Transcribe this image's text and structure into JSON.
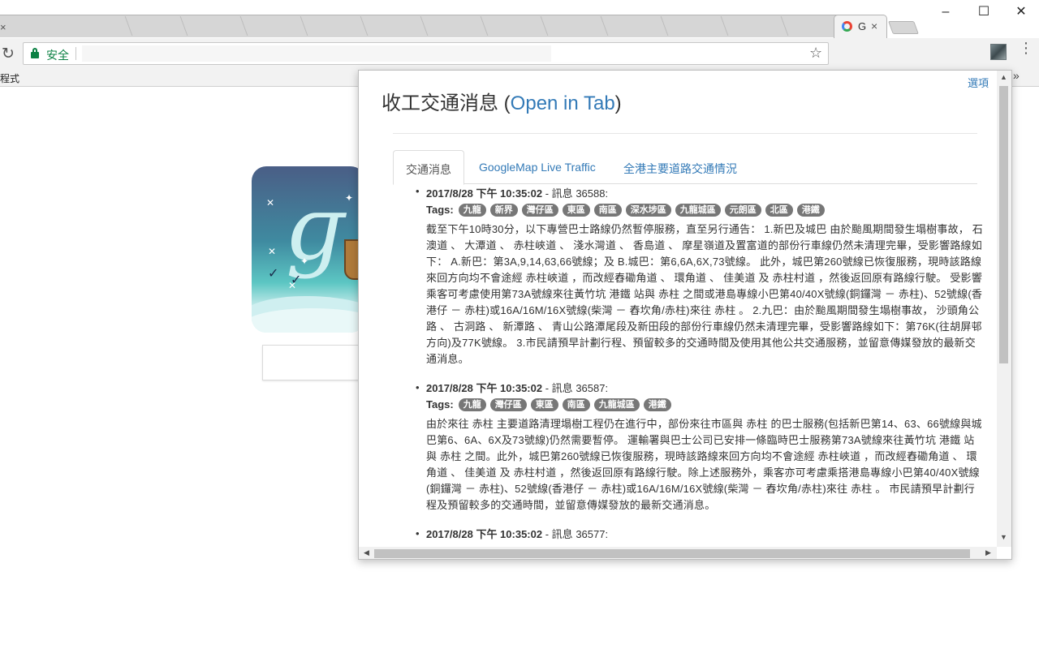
{
  "browser": {
    "active_tab_title": "G",
    "tab_close": "×",
    "omnibox_secure_label": "安全",
    "bookmark_label": "程式",
    "left_tab_close": "×",
    "bookmarks_more": "»"
  },
  "popup": {
    "options_label": "選項",
    "title": "收工交通消息 (",
    "title_link": "Open in Tab",
    "title_end": ")",
    "tabs": [
      {
        "label": "交通消息",
        "active": true
      },
      {
        "label": "GoogleMap Live Traffic",
        "active": false
      },
      {
        "label": "全港主要道路交通情況",
        "active": false
      }
    ],
    "tags_label": "Tags:",
    "msg_prefix": "- 訊息",
    "news": [
      {
        "datetime": "2017/8/28 下午 10:35:02",
        "msg_id": "36588:",
        "tags": [
          "九龍",
          "新界",
          "灣仔區",
          "東區",
          "南區",
          "深水埗區",
          "九龍城區",
          "元朗區",
          "北區",
          "港鐵"
        ],
        "body": "截至下午10時30分，以下專營巴士路線仍然暫停服務，直至另行通告： 1.新巴及城巴 由於颱風期間發生塌樹事故， 石澳道 、 大潭道 、 赤柱峽道 、 淺水灣道 、 香島道 、 摩星嶺道及置富道的部份行車線仍然未清理完畢，受影響路線如下： A.新巴：第3A,9,14,63,66號線；及 B.城巴：第6,6A,6X,73號線。 此外，城巴第260號線已恢復服務，現時該路線來回方向均不會途經 赤柱峽道 ，而改經舂磡角道 、 環角道 、 佳美道 及 赤柱村道 ，然後返回原有路線行駛。 受影響乘客可考慮使用第73A號線來往黃竹坑 港鐵 站與 赤柱 之間或港島專線小巴第40/40X號線(銅鑼灣 － 赤柱)、52號線(香港仔 － 赤柱)或16A/16M/16X號線(柴灣 － 舂坎角/赤柱)來往 赤柱 。 2.九巴：由於颱風期間發生塌樹事故， 沙頭角公路 、 古洞路 、 新潭路 、 青山公路潭尾段及新田段的部份行車線仍然未清理完畢，受影響路線如下：第76K(往胡屏邨方向)及77K號線。 3.市民請預早計劃行程、預留較多的交通時間及使用其他公共交通服務，並留意傳媒發放的最新交通消息。"
      },
      {
        "datetime": "2017/8/28 下午 10:35:02",
        "msg_id": "36587:",
        "tags": [
          "九龍",
          "灣仔區",
          "東區",
          "南區",
          "九龍城區",
          "港鐵"
        ],
        "body": "由於來往 赤柱 主要道路清理塌樹工程仍在進行中，部份來往市區與 赤柱 的巴士服務(包括新巴第14、63、66號線與城巴第6、6A、6X及73號線)仍然需要暫停。 運輸署與巴士公司已安排一條臨時巴士服務第73A號線來往黃竹坑 港鐵 站與 赤柱 之間。此外，城巴第260號線已恢復服務，現時該路線來回方向均不會途經 赤柱峽道 ，而改經舂磡角道 、 環角道 、 佳美道 及 赤柱村道 ，然後返回原有路線行駛。除上述服務外，乘客亦可考慮乘搭港島專線小巴第40/40X號線(銅鑼灣 － 赤柱)、52號線(香港仔 － 赤柱)或16A/16M/16X號線(柴灣 － 舂坎角/赤柱)來往 赤柱 。 市民請預早計劃行程及預留較多的交通時間，並留意傳媒發放的最新交通消息。"
      },
      {
        "datetime": "2017/8/28 下午 10:35:02",
        "msg_id": "36577:",
        "tags": [],
        "body": ""
      }
    ]
  },
  "colors": {
    "link": "#337ab7",
    "tag_bg": "#777777",
    "secure_green": "#0b8043"
  }
}
